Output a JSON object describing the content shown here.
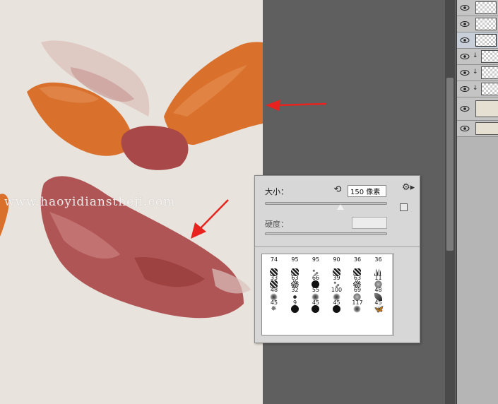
{
  "canvas": {
    "watermark": "www.haoyidianstheji.com",
    "background_color": "#e8e3dc",
    "paint_colors": [
      "#d9702b",
      "#a84848",
      "#c27c7a"
    ]
  },
  "brush_picker": {
    "size_label": "大小：",
    "size_value": "150 像素",
    "size_slider_fraction": 0.62,
    "hardness_label": "硬度：",
    "hardness_value": "",
    "presets": [
      {
        "num": "74",
        "tip": "none"
      },
      {
        "num": "95",
        "tip": "none"
      },
      {
        "num": "95",
        "tip": "none"
      },
      {
        "num": "90",
        "tip": "none"
      },
      {
        "num": "36",
        "tip": "none"
      },
      {
        "num": "36",
        "tip": "none"
      },
      {
        "num": "33",
        "tip": "splat"
      },
      {
        "num": "63",
        "tip": "splat"
      },
      {
        "num": "66",
        "tip": "speckle"
      },
      {
        "num": "39",
        "tip": "splat"
      },
      {
        "num": "63",
        "tip": "splat"
      },
      {
        "num": "11",
        "tip": "grass"
      },
      {
        "num": "48",
        "tip": "splat"
      },
      {
        "num": "32",
        "tip": "star"
      },
      {
        "num": "55",
        "tip": "hard"
      },
      {
        "num": "100",
        "tip": "speckle"
      },
      {
        "num": "69",
        "tip": "star"
      },
      {
        "num": "48",
        "tip": "texture"
      },
      {
        "num": "45",
        "tip": "soft"
      },
      {
        "num": "9",
        "tip": "dot"
      },
      {
        "num": "45",
        "tip": "soft"
      },
      {
        "num": "45",
        "tip": "soft"
      },
      {
        "num": "117",
        "tip": "texture"
      },
      {
        "num": "45",
        "tip": "leaf"
      },
      {
        "num": "",
        "tip": "maple"
      },
      {
        "num": "",
        "tip": "hard"
      },
      {
        "num": "",
        "tip": "hard"
      },
      {
        "num": "",
        "tip": "hard"
      },
      {
        "num": "",
        "tip": "soft"
      },
      {
        "num": "",
        "tip": "fly"
      }
    ],
    "icons": {
      "reset": "reset-icon",
      "gear": "gear-icon",
      "new_preset": "new-preset-icon"
    }
  },
  "layers_panel": {
    "rows": [
      {
        "type": "checker",
        "clipped": false
      },
      {
        "type": "checker",
        "clipped": false
      },
      {
        "type": "checker",
        "clipped": false,
        "selected": true
      },
      {
        "type": "checker",
        "clipped": true
      },
      {
        "type": "checker",
        "clipped": true
      },
      {
        "type": "checker",
        "clipped": true
      },
      {
        "type": "fill",
        "clipped": false
      },
      {
        "type": "fill",
        "clipped": false
      }
    ]
  },
  "annotation": {
    "arrow_color": "#e8231f"
  }
}
